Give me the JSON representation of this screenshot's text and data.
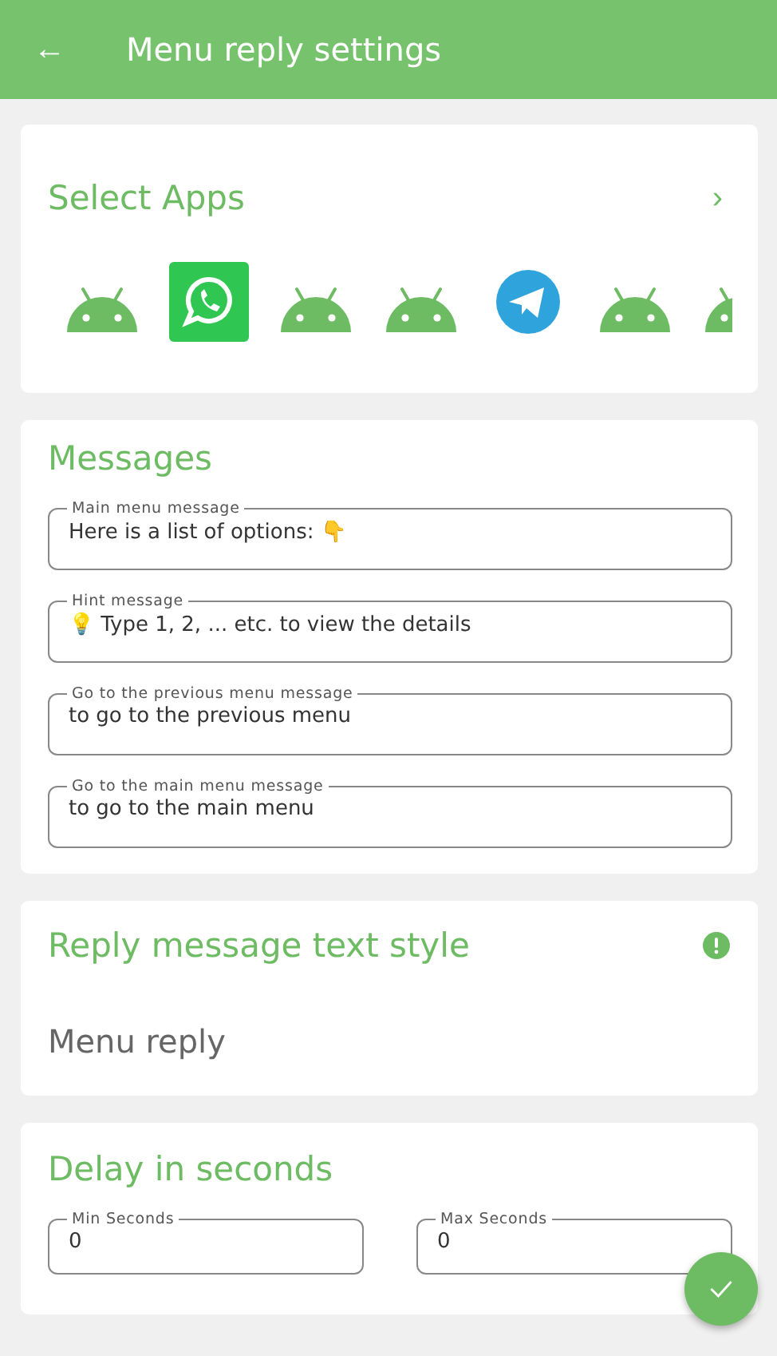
{
  "app_bar": {
    "back": "←",
    "title": "Menu reply settings"
  },
  "select_apps": {
    "title": "Select Apps",
    "chevron": "›",
    "apps": [
      {
        "kind": "android"
      },
      {
        "kind": "whatsapp"
      },
      {
        "kind": "android"
      },
      {
        "kind": "android"
      },
      {
        "kind": "telegram"
      },
      {
        "kind": "android"
      },
      {
        "kind": "android"
      }
    ]
  },
  "messages": {
    "title": "Messages",
    "fields": [
      {
        "label": "Main menu message",
        "value": "Here is a list of options: 👇"
      },
      {
        "label": "Hint message",
        "value": "💡 Type 1, 2, ... etc. to view the details"
      },
      {
        "label": "Go to the previous menu message",
        "value": "to go to the previous menu"
      },
      {
        "label": "Go to the main menu message",
        "value": "to go to the main menu"
      }
    ]
  },
  "text_style": {
    "title": "Reply message text style",
    "value": "Menu reply"
  },
  "delay": {
    "title": "Delay in seconds",
    "fields": [
      {
        "label": "Min Seconds",
        "value": "0"
      },
      {
        "label": "Max Seconds",
        "value": "0"
      }
    ]
  }
}
